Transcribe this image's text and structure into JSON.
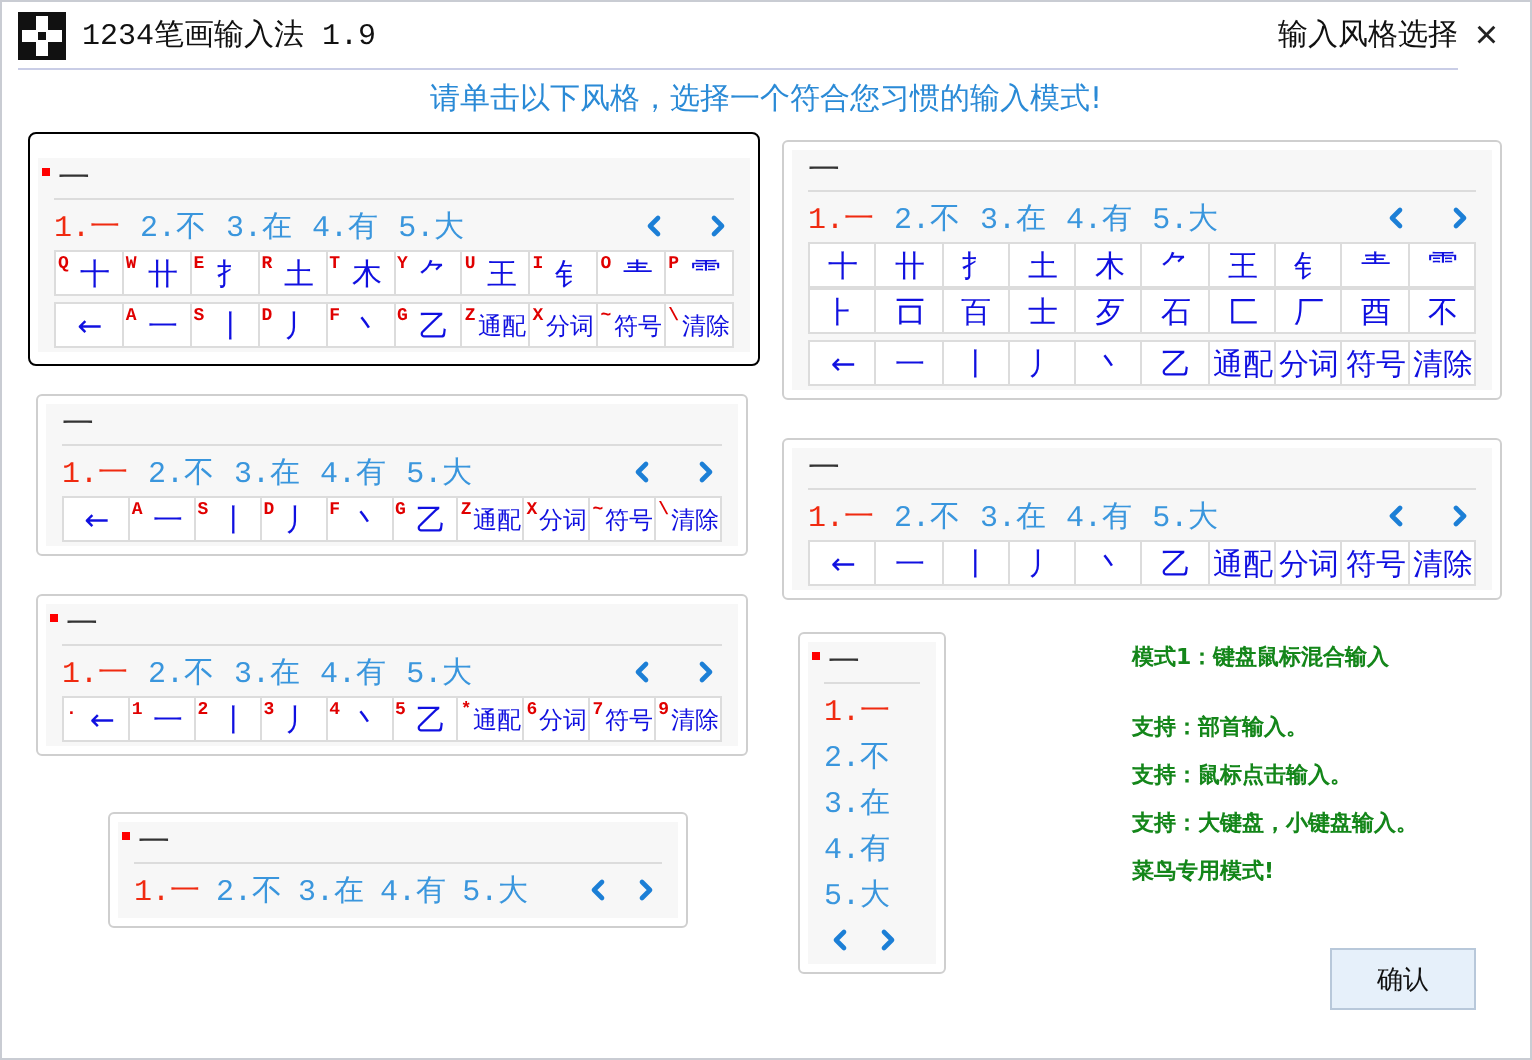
{
  "window": {
    "title": "1234笔画输入法 1.9",
    "subtitle": "输入风格选择",
    "close": "×"
  },
  "instruction": "请单击以下风格，选择一个符合您习惯的输入模式!",
  "styles": [
    {
      "kind": "keyboard",
      "selected": true,
      "marker": true,
      "composition": "一",
      "candidates": [
        {
          "label": "1.一",
          "selected": true
        },
        {
          "label": "2.不",
          "selected": false
        },
        {
          "label": "3.在",
          "selected": false
        },
        {
          "label": "4.有",
          "selected": false
        },
        {
          "label": "5.大",
          "selected": false
        }
      ],
      "key_rows": [
        [
          {
            "hint": "Q",
            "glyph": "十"
          },
          {
            "hint": "W",
            "glyph": "卄"
          },
          {
            "hint": "E",
            "glyph": "扌"
          },
          {
            "hint": "R",
            "glyph": "土"
          },
          {
            "hint": "T",
            "glyph": "木"
          },
          {
            "hint": "Y",
            "glyph": "⺈"
          },
          {
            "hint": "U",
            "glyph": "王"
          },
          {
            "hint": "I",
            "glyph": "钅"
          },
          {
            "hint": "O",
            "glyph": "龶"
          },
          {
            "hint": "P",
            "glyph": "⻗"
          }
        ],
        [
          {
            "glyph": "←"
          },
          {
            "hint": "A",
            "glyph": "一"
          },
          {
            "hint": "S",
            "glyph": "丨"
          },
          {
            "hint": "D",
            "glyph": "丿"
          },
          {
            "hint": "F",
            "glyph": "丶"
          },
          {
            "hint": "G",
            "glyph": "乙"
          },
          {
            "hint": "Z",
            "glyph": "通配"
          },
          {
            "hint": "X",
            "glyph": "分词"
          },
          {
            "hint": "~",
            "glyph": "符号"
          },
          {
            "hint": "\\",
            "glyph": "清除"
          }
        ]
      ]
    },
    {
      "kind": "keyboard",
      "selected": false,
      "marker": false,
      "composition": "一",
      "candidates": [
        {
          "label": "1.一",
          "selected": true
        },
        {
          "label": "2.不",
          "selected": false
        },
        {
          "label": "3.在",
          "selected": false
        },
        {
          "label": "4.有",
          "selected": false
        },
        {
          "label": "5.大",
          "selected": false
        }
      ],
      "key_rows": [
        [
          {
            "glyph": "十"
          },
          {
            "glyph": "卄"
          },
          {
            "glyph": "扌"
          },
          {
            "glyph": "土"
          },
          {
            "glyph": "木"
          },
          {
            "glyph": "⺈"
          },
          {
            "glyph": "王"
          },
          {
            "glyph": "钅"
          },
          {
            "glyph": "龶"
          },
          {
            "glyph": "⻗"
          }
        ],
        [
          {
            "glyph": "⺊"
          },
          {
            "glyph": "𠮛"
          },
          {
            "glyph": "百"
          },
          {
            "glyph": "士"
          },
          {
            "glyph": "歹"
          },
          {
            "glyph": "石"
          },
          {
            "glyph": "匚"
          },
          {
            "glyph": "厂"
          },
          {
            "glyph": "酉"
          },
          {
            "glyph": "不"
          }
        ],
        [
          {
            "glyph": "←"
          },
          {
            "glyph": "一"
          },
          {
            "glyph": "丨"
          },
          {
            "glyph": "丿"
          },
          {
            "glyph": "丶"
          },
          {
            "glyph": "乙"
          },
          {
            "glyph": "通配"
          },
          {
            "glyph": "分词"
          },
          {
            "glyph": "符号"
          },
          {
            "glyph": "清除"
          }
        ]
      ]
    },
    {
      "kind": "keyboard",
      "selected": false,
      "marker": false,
      "composition": "一",
      "candidates": [
        {
          "label": "1.一",
          "selected": true
        },
        {
          "label": "2.不",
          "selected": false
        },
        {
          "label": "3.在",
          "selected": false
        },
        {
          "label": "4.有",
          "selected": false
        },
        {
          "label": "5.大",
          "selected": false
        }
      ],
      "key_rows": [
        [
          {
            "glyph": "←"
          },
          {
            "hint": "A",
            "glyph": "一"
          },
          {
            "hint": "S",
            "glyph": "丨"
          },
          {
            "hint": "D",
            "glyph": "丿"
          },
          {
            "hint": "F",
            "glyph": "丶"
          },
          {
            "hint": "G",
            "glyph": "乙"
          },
          {
            "hint": "Z",
            "glyph": "通配"
          },
          {
            "hint": "X",
            "glyph": "分词"
          },
          {
            "hint": "~",
            "glyph": "符号"
          },
          {
            "hint": "\\",
            "glyph": "清除"
          }
        ]
      ]
    },
    {
      "kind": "keyboard",
      "selected": false,
      "marker": false,
      "composition": "一",
      "candidates": [
        {
          "label": "1.一",
          "selected": true
        },
        {
          "label": "2.不",
          "selected": false
        },
        {
          "label": "3.在",
          "selected": false
        },
        {
          "label": "4.有",
          "selected": false
        },
        {
          "label": "5.大",
          "selected": false
        }
      ],
      "key_rows": [
        [
          {
            "glyph": "←"
          },
          {
            "glyph": "一"
          },
          {
            "glyph": "丨"
          },
          {
            "glyph": "丿"
          },
          {
            "glyph": "丶"
          },
          {
            "glyph": "乙"
          },
          {
            "glyph": "通配"
          },
          {
            "glyph": "分词"
          },
          {
            "glyph": "符号"
          },
          {
            "glyph": "清除"
          }
        ]
      ]
    },
    {
      "kind": "keyboard",
      "selected": false,
      "marker": true,
      "composition": "一",
      "candidates": [
        {
          "label": "1.一",
          "selected": true
        },
        {
          "label": "2.不",
          "selected": false
        },
        {
          "label": "3.在",
          "selected": false
        },
        {
          "label": "4.有",
          "selected": false
        },
        {
          "label": "5.大",
          "selected": false
        }
      ],
      "key_rows": [
        [
          {
            "hint": ".",
            "glyph": "←"
          },
          {
            "hint": "1",
            "glyph": "一"
          },
          {
            "hint": "2",
            "glyph": "丨"
          },
          {
            "hint": "3",
            "glyph": "丿"
          },
          {
            "hint": "4",
            "glyph": "丶"
          },
          {
            "hint": "5",
            "glyph": "乙"
          },
          {
            "hint": "*",
            "glyph": "通配"
          },
          {
            "hint": "6",
            "glyph": "分词"
          },
          {
            "hint": "7",
            "glyph": "符号"
          },
          {
            "hint": "9",
            "glyph": "清除"
          }
        ]
      ]
    },
    {
      "kind": "inline",
      "selected": false,
      "marker": true,
      "composition": "一",
      "candidates": [
        {
          "label": "1.一",
          "selected": true
        },
        {
          "label": "2.不",
          "selected": false
        },
        {
          "label": "3.在",
          "selected": false
        },
        {
          "label": "4.有",
          "selected": false
        },
        {
          "label": "5.大",
          "selected": false
        }
      ]
    },
    {
      "kind": "vertical",
      "selected": false,
      "marker": true,
      "composition": "一",
      "candidates": [
        {
          "label": "1.一",
          "selected": true
        },
        {
          "label": "2.不",
          "selected": false
        },
        {
          "label": "3.在",
          "selected": false
        },
        {
          "label": "4.有",
          "selected": false
        },
        {
          "label": "5.大",
          "selected": false
        }
      ]
    }
  ],
  "info": [
    "模式1：键盘鼠标混合输入",
    "支持：部首输入。",
    "支持：鼠标点击输入。",
    "支持：大键盘，小键盘输入。",
    "菜鸟专用模式!"
  ],
  "confirm": "确认"
}
